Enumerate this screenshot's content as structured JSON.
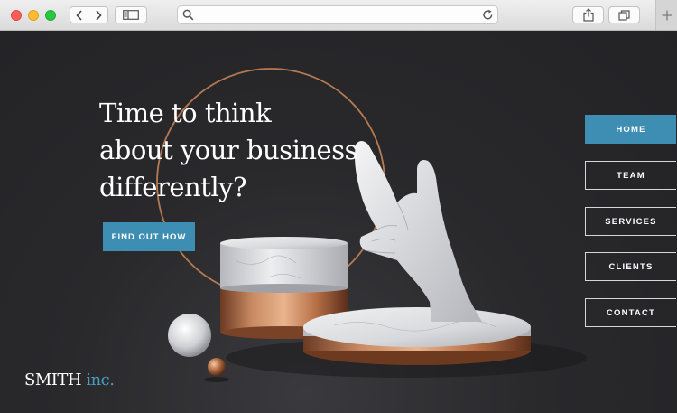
{
  "browser": {
    "icons": [
      "back-arrow-icon",
      "forward-arrow-icon",
      "sidebar-icon",
      "search-icon",
      "reload-icon",
      "share-icon",
      "tabs-icon",
      "plus-icon"
    ]
  },
  "hero": {
    "headline_lines": [
      "Time to think",
      "about your business",
      "differently?"
    ],
    "cta_label": "FIND OUT HOW"
  },
  "nav": {
    "items": [
      {
        "label": "HOME",
        "active": true
      },
      {
        "label": "TEAM",
        "active": false
      },
      {
        "label": "SERVICES",
        "active": false
      },
      {
        "label": "CLIENTS",
        "active": false
      },
      {
        "label": "CONTACT",
        "active": false
      }
    ]
  },
  "brand": {
    "name": "SMITH",
    "suffix": "inc.",
    "accent_color": "#3d8eb2"
  }
}
